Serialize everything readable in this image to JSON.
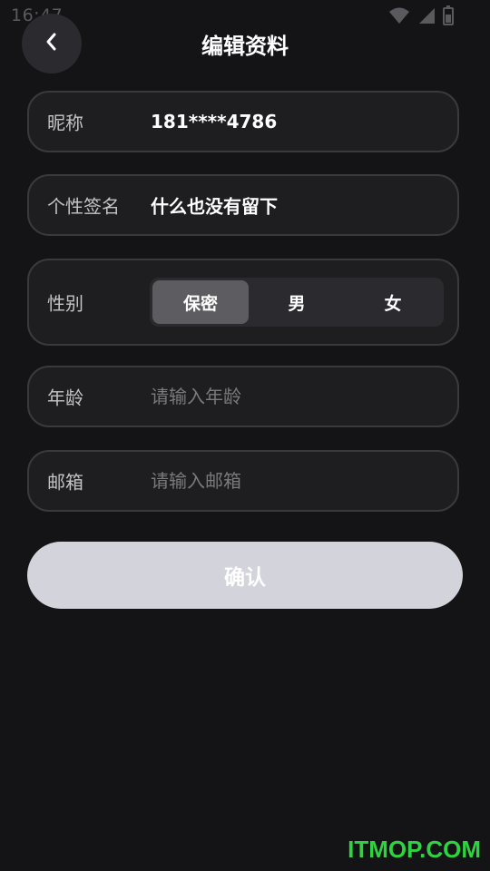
{
  "status_bar": {
    "time": "16:47",
    "icons": [
      "wifi-icon",
      "signal-icon",
      "battery-icon"
    ]
  },
  "header": {
    "back_icon": "chevron-left-icon",
    "title": "编辑资料"
  },
  "form": {
    "nickname": {
      "label": "昵称",
      "value": "181****4786"
    },
    "signature": {
      "label": "个性签名",
      "value": "什么也没有留下"
    },
    "gender": {
      "label": "性别",
      "options": [
        "保密",
        "男",
        "女"
      ],
      "selected": "保密"
    },
    "age": {
      "label": "年龄",
      "value": "",
      "placeholder": "请输入年龄"
    },
    "email": {
      "label": "邮箱",
      "value": "",
      "placeholder": "请输入邮箱"
    }
  },
  "confirm_label": "确认",
  "watermark": "ITMOP.COM",
  "colors": {
    "background": "#141416",
    "row_background": "#1e1e21",
    "row_border": "#3a3a3e",
    "segment_active": "#5d5d61",
    "button_background": "#d3d3db",
    "watermark": "#2fd23f"
  }
}
